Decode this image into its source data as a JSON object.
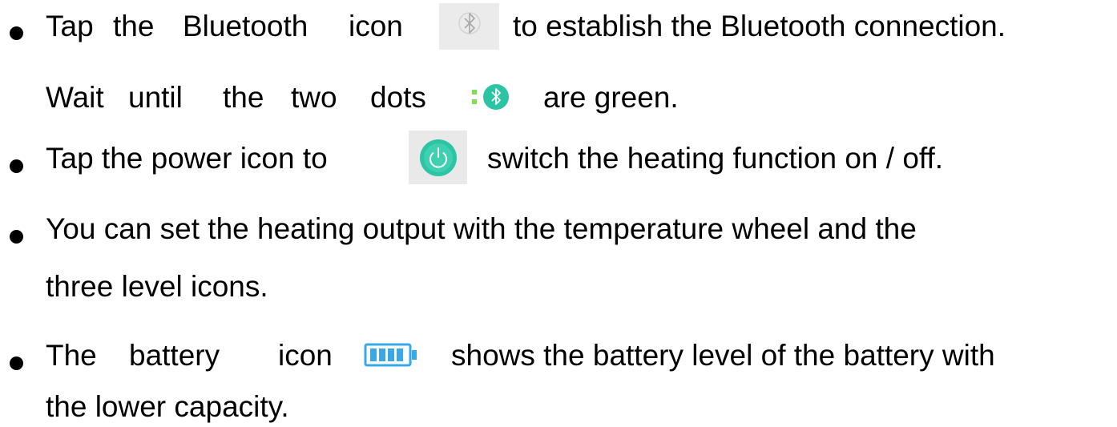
{
  "items": [
    {
      "line1_words": [
        "Tap",
        "the",
        "Bluetooth",
        "icon"
      ],
      "line1_rest": "to establish the Bluetooth connection.",
      "line2_words": [
        "Wait",
        "until",
        "the",
        "two",
        "dots"
      ],
      "line2_rest": "are green."
    },
    {
      "line1_pre": "Tap the power icon to",
      "line1_rest": "switch the heating function on / off."
    },
    {
      "line1": "You can set the heating output with the temperature wheel and the",
      "line2": "three level icons."
    },
    {
      "line1_words": [
        "The",
        "battery",
        "icon"
      ],
      "line1_rest": "shows the battery level of the battery with",
      "line2": "the lower capacity."
    }
  ],
  "icons": {
    "bluetooth_icon": "bluetooth-icon",
    "connection_dots_icon": "connection-dots-icon",
    "power_icon": "power-icon",
    "battery_icon": "battery-icon"
  },
  "colors": {
    "text": "#000000",
    "teal": "#2bc4a4",
    "green_dots": "#7fe04a",
    "icon_grey": "#b8b8b8",
    "battery_blue": "#3aa8e6"
  }
}
